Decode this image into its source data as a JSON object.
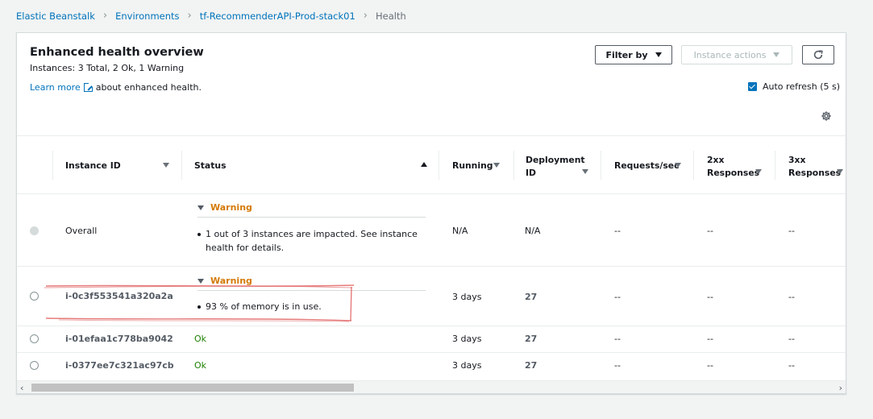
{
  "breadcrumb": {
    "items": [
      "Elastic Beanstalk",
      "Environments",
      "tf-RecommenderAPI-Prod-stack01"
    ],
    "current": "Health"
  },
  "header": {
    "title": "Enhanced health overview",
    "instances_summary": "Instances: 3 Total, 2 Ok, 1 Warning",
    "learn_more": "Learn more",
    "learn_more_suffix": "about enhanced health."
  },
  "toolbar": {
    "filter_label": "Filter by",
    "actions_label": "Instance actions",
    "auto_refresh_label": "Auto refresh (5 s)",
    "auto_refresh_checked": true
  },
  "table": {
    "columns": {
      "instance_id": "Instance ID",
      "status": "Status",
      "running": "Running",
      "deployment_id_1": "Deployment",
      "deployment_id_2": "ID",
      "requests": "Requests/sec",
      "r2xx_1": "2xx",
      "r2xx_2": "Responses",
      "r3xx_1": "3xx",
      "r3xx_2": "Responses"
    },
    "rows": [
      {
        "id": "Overall",
        "status": "Warning",
        "cause_1": "1 out of 3 instances are impacted. See instance",
        "cause_2": "health for details.",
        "running": "N/A",
        "deployment": "N/A",
        "requests": "--",
        "r2xx": "--",
        "r3xx": "--"
      },
      {
        "id": "i-0c3f553541a320a2a",
        "status": "Warning",
        "cause_1": "93 % of memory is in use.",
        "running": "3 days",
        "deployment": "27",
        "requests": "--",
        "r2xx": "--",
        "r3xx": "--"
      },
      {
        "id": "i-01efaa1c778ba9042",
        "status": "Ok",
        "running": "3 days",
        "deployment": "27",
        "requests": "--",
        "r2xx": "--",
        "r3xx": "--"
      },
      {
        "id": "i-0377ee7c321ac97cb",
        "status": "Ok",
        "running": "3 days",
        "deployment": "27",
        "requests": "--",
        "r2xx": "--",
        "r3xx": "--"
      }
    ]
  },
  "colors": {
    "link": "#0073bb",
    "warning": "#d47a06",
    "ok": "#1d8102",
    "annotation": "#e05a5a"
  },
  "icons": [
    "chevron-right-icon",
    "external-link-icon",
    "caret-down-icon",
    "refresh-icon",
    "checkbox-icon",
    "gear-icon",
    "sort-ascending-icon",
    "sort-icon"
  ]
}
